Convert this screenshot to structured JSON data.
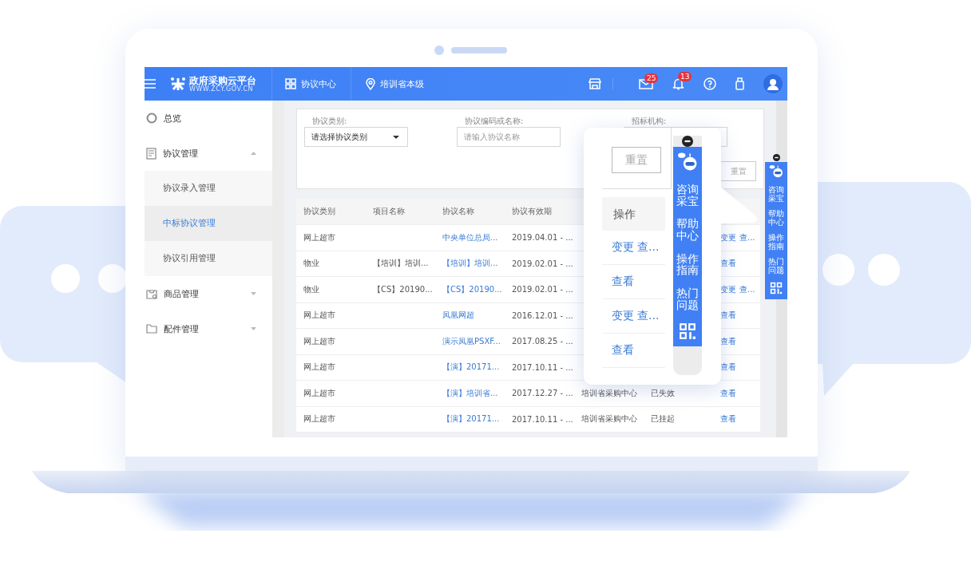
{
  "header": {
    "logo_title": "政府采购云平台",
    "logo_url": "WWW.ZCY.GOV.CN",
    "nav": [
      {
        "kind": "grid",
        "label": "协议中心"
      },
      {
        "kind": "pin",
        "label": "培训省本级"
      }
    ],
    "actions": [
      {
        "kind": "store"
      },
      {
        "kind": "mail",
        "badge": "25"
      },
      {
        "kind": "bell",
        "badge": "13"
      },
      {
        "kind": "help"
      },
      {
        "kind": "device"
      },
      {
        "kind": "avatar"
      }
    ]
  },
  "sidebar": {
    "items": [
      {
        "kind": "link",
        "label": "总览"
      },
      {
        "kind": "group",
        "label": "协议管理",
        "expanded": true,
        "children": [
          {
            "label": "协议录入管理",
            "selected": false
          },
          {
            "label": "中标协议管理",
            "selected": true
          },
          {
            "label": "协议引用管理",
            "selected": false
          }
        ]
      },
      {
        "kind": "group",
        "label": "商品管理",
        "expanded": false
      },
      {
        "kind": "group",
        "label": "配件管理",
        "expanded": false
      }
    ]
  },
  "filters": [
    {
      "kind": "select",
      "label": "协议类别:",
      "value": "请选择协议类别"
    },
    {
      "kind": "input",
      "label": "协议编码或名称:",
      "placeholder": "请输入协议名称"
    },
    {
      "kind": "input",
      "label": "招标机构:"
    }
  ],
  "reset_button": "重置",
  "table": {
    "columns": [
      "协议类别",
      "项目名称",
      "协议名称",
      "协议有效期"
    ],
    "rows": [
      [
        "网上超市",
        null,
        "中央单位总局...",
        "2019.04.01 - ...",
        null,
        null,
        [
          "变更",
          "查..."
        ]
      ],
      [
        "物业",
        "【培训】培训...",
        "【培训】培训...",
        "2019.02.01 - ...",
        null,
        null,
        [
          "查看"
        ]
      ],
      [
        "物业",
        "【CS】20190...",
        "【CS】20190...",
        "2019.02.01 - ...",
        null,
        null,
        [
          "变更",
          "查..."
        ]
      ],
      [
        "网上超市",
        null,
        "凤凰网超",
        "2016.12.01 - ...",
        null,
        null,
        [
          "查看"
        ]
      ],
      [
        "网上超市",
        null,
        "演示凤凰PSXF...",
        "2017.08.25 - ...",
        null,
        null,
        [
          "查看"
        ]
      ],
      [
        "网上超市",
        null,
        "【演】20171...",
        "2017.10.11 - ...",
        null,
        null,
        [
          "查看"
        ]
      ],
      [
        "网上超市",
        null,
        "【演】培训省...",
        "2017.12.27 - ...",
        "培训省采购中心",
        "已失效",
        [
          "查看"
        ]
      ],
      [
        "网上超市",
        null,
        "【演】20171...",
        "2017.10.11 - ...",
        "培训省采购中心",
        "已挂起",
        [
          "查看"
        ]
      ]
    ]
  },
  "side_toolbar": {
    "items": [
      {
        "kind": "robot"
      },
      {
        "kind": "text",
        "label": "咨询采宝"
      },
      {
        "kind": "text",
        "label": "帮助中心"
      },
      {
        "kind": "text",
        "label": "操作指南"
      },
      {
        "kind": "text",
        "label": "热门问题"
      },
      {
        "kind": "qr"
      }
    ]
  },
  "zoom_popup": {
    "reset_button": "重置",
    "column_header": "操作",
    "rows": [
      [
        "变更",
        "查..."
      ],
      [
        "查看"
      ],
      [
        "变更",
        "查..."
      ],
      [
        "查看"
      ]
    ],
    "toolbar": {
      "items": [
        {
          "kind": "robot"
        },
        {
          "kind": "text",
          "label": "咨询采宝"
        },
        {
          "kind": "text",
          "label": "帮助中心"
        },
        {
          "kind": "text",
          "label": "操作指南"
        },
        {
          "kind": "text",
          "label": "热门问题"
        },
        {
          "kind": "qr"
        }
      ]
    }
  }
}
